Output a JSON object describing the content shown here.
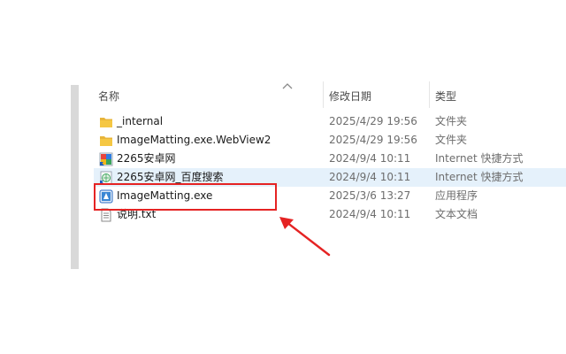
{
  "columns": {
    "name": "名称",
    "modified": "修改日期",
    "type": "类型"
  },
  "files": [
    {
      "name": "_internal",
      "modified": "2025/4/29 19:56",
      "type": "文件夹",
      "icon": "folder-icon"
    },
    {
      "name": "ImageMatting.exe.WebView2",
      "modified": "2025/4/29 19:56",
      "type": "文件夹",
      "icon": "folder-icon"
    },
    {
      "name": "2265安卓网",
      "modified": "2024/9/4 10:11",
      "type": "Internet 快捷方式",
      "icon": "internet-shortcut-icon"
    },
    {
      "name": "2265安卓网_百度搜索",
      "modified": "2024/9/4 10:11",
      "type": "Internet 快捷方式",
      "icon": "internet-shortcut-icon"
    },
    {
      "name": "ImageMatting.exe",
      "modified": "2025/3/6 13:27",
      "type": "应用程序",
      "icon": "application-icon"
    },
    {
      "name": "说明.txt",
      "modified": "2024/9/4 10:11",
      "type": "文本文档",
      "icon": "text-document-icon"
    }
  ],
  "annotation": {
    "color": "#e52323",
    "highlighted_file": "ImageMatting.exe"
  },
  "colors": {
    "hover_row": "#e5f1fb",
    "folder": "#f5c743"
  }
}
